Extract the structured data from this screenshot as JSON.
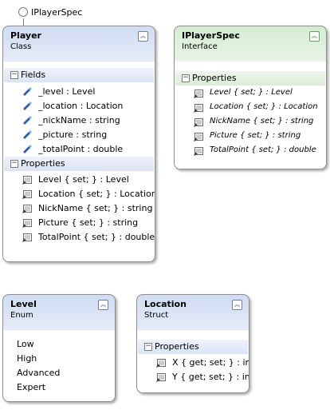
{
  "lollipop": {
    "label": "IPlayerSpec"
  },
  "player": {
    "title": "Player",
    "subtitle": "Class",
    "collapse_glyph": "︽",
    "sections": [
      {
        "label": "Fields",
        "toggle": "−",
        "members": [
          "_level : Level",
          "_location : Location",
          "_nickName : string",
          "_picture : string",
          "_totalPoint : double"
        ]
      },
      {
        "label": "Properties",
        "toggle": "−",
        "members": [
          "Level { set; } : Level",
          "Location { set; } : Location",
          "NickName { set; } : string",
          "Picture { set; } : string",
          "TotalPoint { set; } : double"
        ]
      }
    ]
  },
  "iplayerspec": {
    "title": "IPlayerSpec",
    "subtitle": "Interface",
    "collapse_glyph": "︽",
    "sections": [
      {
        "label": "Properties",
        "toggle": "−",
        "members": [
          "Level { set; } : Level",
          "Location { set; } : Location",
          "NickName { set; } : string",
          "Picture { set; } : string",
          "TotalPoint { set; } : double"
        ]
      }
    ]
  },
  "level": {
    "title": "Level",
    "subtitle": "Enum",
    "collapse_glyph": "︽",
    "values": [
      "Low",
      "High",
      "Advanced",
      "Expert"
    ]
  },
  "location": {
    "title": "Location",
    "subtitle": "Struct",
    "collapse_glyph": "︽",
    "sections": [
      {
        "label": "Properties",
        "toggle": "−",
        "members": [
          "X { get; set; } : int",
          "Y { get; set; } : int"
        ]
      }
    ]
  },
  "colors": {
    "class_header": "#cfdcf2",
    "interface_header": "#d4ecd2",
    "field_icon": "#2f5fb4",
    "property_icon": "#6b6b6b"
  },
  "icons": {
    "field": "field-icon",
    "property": "property-icon"
  }
}
